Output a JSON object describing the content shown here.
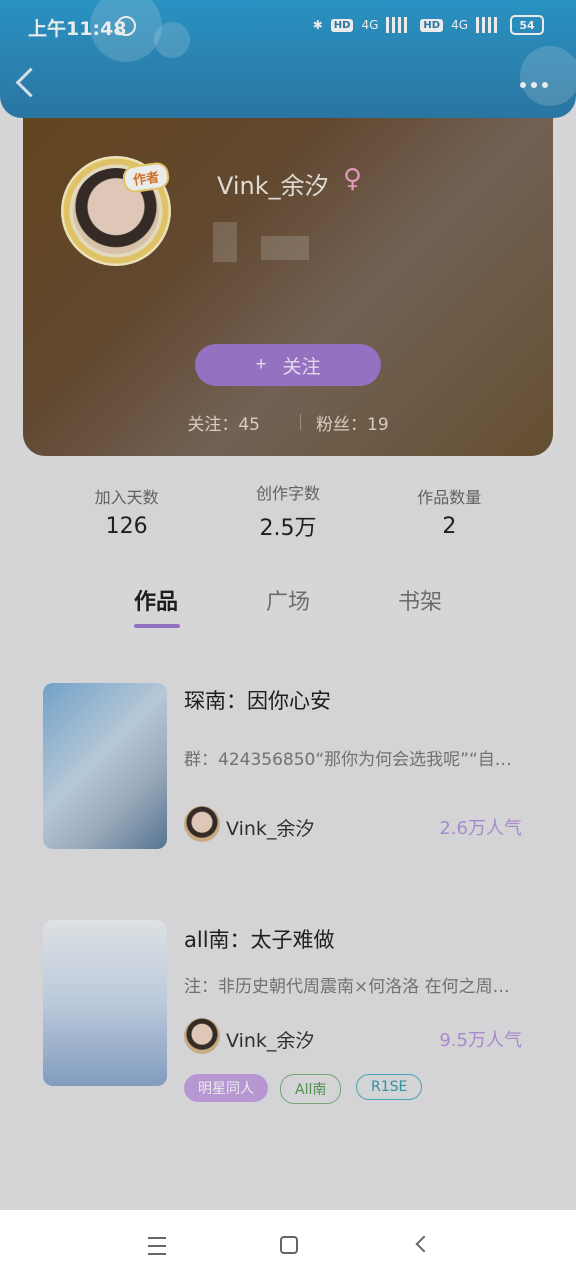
{
  "status_bar": {
    "time": "上午11:48",
    "network_badge_1": "HD",
    "network_type_1": "4G",
    "network_badge_2": "HD",
    "network_type_2": "4G",
    "battery": "54"
  },
  "profile": {
    "username": "Vink_余汐",
    "gender_symbol": "♀",
    "author_tag": "作者",
    "follow_button": {
      "icon": "+",
      "label": "关注"
    },
    "following": "关注：45",
    "fans": "粉丝：19"
  },
  "stats": [
    {
      "label": "加入天数",
      "value": "126"
    },
    {
      "label": "创作字数",
      "value": "2.5万"
    },
    {
      "label": "作品数量",
      "value": "2"
    }
  ],
  "tabs": [
    {
      "label": "作品",
      "active": true
    },
    {
      "label": "广场",
      "active": false
    },
    {
      "label": "书架",
      "active": false
    }
  ],
  "works": [
    {
      "title": "琛南：因你心安",
      "description": "群：424356850“那你为何会选我呢”“自…",
      "author": "Vink_余汐",
      "popularity": "2.6万人气"
    },
    {
      "title": "all南：太子难做",
      "description": "注：非历史朝代周震南×何洛洛  在何之周…",
      "author": "Vink_余汐",
      "popularity": "9.5万人气",
      "tags": [
        "明星同人",
        "All南",
        "R1SE"
      ]
    }
  ],
  "icons": {
    "back": "back-chevron-icon",
    "more": "more-dots-icon",
    "nav_menu": "menu-icon",
    "nav_home": "home-icon",
    "nav_back": "back-icon"
  }
}
